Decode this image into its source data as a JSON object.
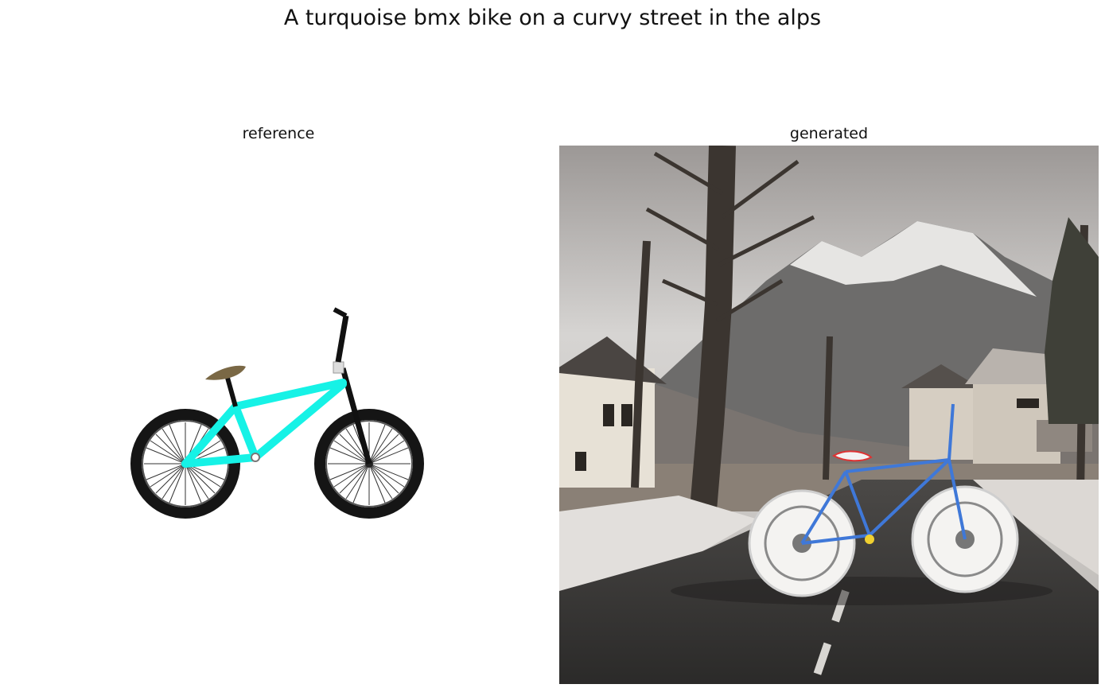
{
  "figure": {
    "title": "A turquoise bmx bike on a curvy street in the alps"
  },
  "panels": [
    {
      "title": "reference",
      "image": "turquoise bmx bike side view on white background"
    },
    {
      "title": "generated",
      "image": "white and blue bike on a curvy road with houses, bare trees and snowy alpine mountains"
    }
  ],
  "colors": {
    "frame_turquoise": "#16f2e6",
    "tire_black": "#151515",
    "saddle_brown": "#7a6845",
    "generated_bike_blue": "#3f78d8",
    "road_gray": "#3a3836",
    "sky_gray": "#cfcfcf"
  }
}
